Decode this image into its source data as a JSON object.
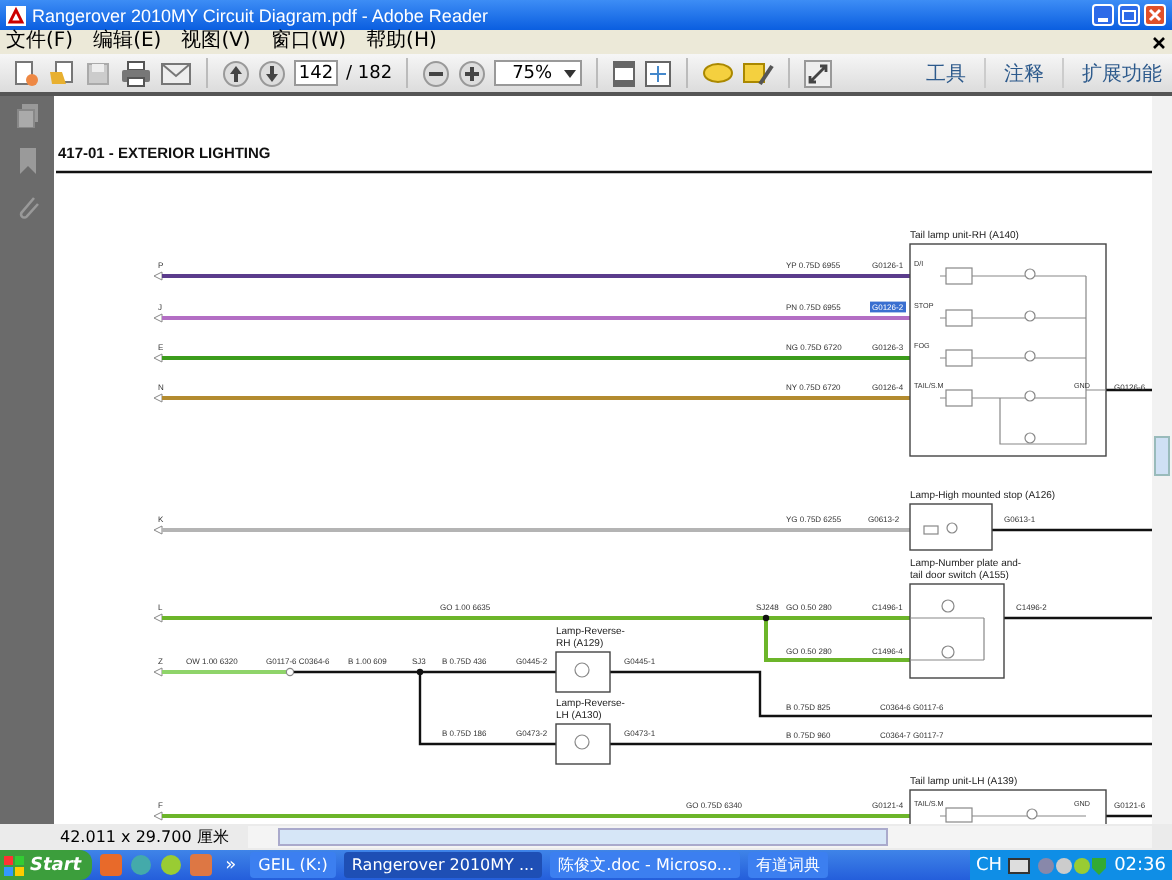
{
  "window": {
    "title": "Rangerover 2010MY Circuit Diagram.pdf - Adobe Reader"
  },
  "menu": [
    "文件(F)",
    "编辑(E)",
    "视图(V)",
    "窗口(W)",
    "帮助(H)"
  ],
  "toolbar": {
    "page": "142",
    "page_total": "/ 182",
    "zoom": "75%",
    "panels": [
      "工具",
      "注释",
      "扩展功能"
    ]
  },
  "diagram": {
    "title": "417-01 - EXTERIOR LIGHTING",
    "inputs": [
      {
        "letter": "P",
        "color": "#5b3c8c"
      },
      {
        "letter": "J",
        "color": "#b36ec4"
      },
      {
        "letter": "E",
        "color": "#3c9c1c"
      },
      {
        "letter": "N",
        "color": "#b38b2f"
      },
      {
        "letter": "K",
        "color": "#b4b4b4"
      },
      {
        "letter": "L",
        "color": "#6cb52a"
      },
      {
        "letter": "Z",
        "color": "#8fd46a"
      },
      {
        "letter": "F",
        "color": "#6cb52a"
      }
    ],
    "wire_labels": [
      "YP 0.75D 6955",
      "PN 0.75D 6955",
      "NG 0.75D 6720",
      "NY 0.75D 6720",
      "YG 0.75D 6255",
      "GO 1.00 6635",
      "GO 0.50 280",
      "GO 0.50 280",
      "OW 1.00 6320",
      "B 1.00 609",
      "B 0.75D 436",
      "B 0.75D 186",
      "B 0.75D 825",
      "B 0.75D 960",
      "GO 0.75D 6340"
    ],
    "connectors": [
      {
        "text": "G0126-1",
        "highlighted": false
      },
      {
        "text": "G0126-2",
        "highlighted": true
      },
      {
        "text": "G0126-3",
        "highlighted": false
      },
      {
        "text": "G0126-4",
        "highlighted": false
      },
      {
        "text": "G0126-6",
        "highlighted": false
      },
      {
        "text": "G0613-2",
        "highlighted": false
      },
      {
        "text": "G0613-1",
        "highlighted": false
      },
      {
        "text": "C1496-1",
        "highlighted": false
      },
      {
        "text": "C1496-4",
        "highlighted": false
      },
      {
        "text": "C1496-2",
        "highlighted": false
      },
      {
        "text": "G0117-6 C0364-6",
        "highlighted": false
      },
      {
        "text": "G0445-2",
        "highlighted": false
      },
      {
        "text": "G0445-1",
        "highlighted": false
      },
      {
        "text": "G0473-2",
        "highlighted": false
      },
      {
        "text": "G0473-1",
        "highlighted": false
      },
      {
        "text": "C0364-6 G0117-6",
        "highlighted": false
      },
      {
        "text": "C0364-7 G0117-7",
        "highlighted": false
      },
      {
        "text": "G0121-4",
        "highlighted": false
      },
      {
        "text": "G0121-6",
        "highlighted": false
      }
    ],
    "splices": [
      "SJ248",
      "SJ3"
    ],
    "pins": [
      "D/I",
      "STOP",
      "FOG",
      "TAIL/S.M",
      "GND",
      "TAIL/S.M",
      "GND"
    ],
    "components": [
      {
        "name_lines": [
          "Tail lamp unit-RH (A140)"
        ]
      },
      {
        "name_lines": [
          "Lamp-High mounted stop (A126)"
        ]
      },
      {
        "name_lines": [
          "Lamp-Number plate and-",
          "tail door switch (A155)"
        ]
      },
      {
        "name_lines": [
          "Lamp-Reverse-",
          "RH (A129)"
        ]
      },
      {
        "name_lines": [
          "Lamp-Reverse-",
          "LH (A130)"
        ]
      },
      {
        "name_lines": [
          "Tail lamp unit-LH (A139)"
        ]
      }
    ]
  },
  "status_bar": {
    "page_size": "42.011 x 29.700 厘米"
  },
  "taskbar": {
    "start": "Start",
    "more": "»",
    "items": [
      {
        "label": "GEIL (K:)",
        "selected": false
      },
      {
        "label": "Rangerover 2010MY ...",
        "selected": true
      },
      {
        "label": "陈俊文.doc - Microso...",
        "selected": false
      },
      {
        "label": "有道词典",
        "selected": false
      }
    ],
    "language": "CH",
    "clock": "02:36"
  }
}
